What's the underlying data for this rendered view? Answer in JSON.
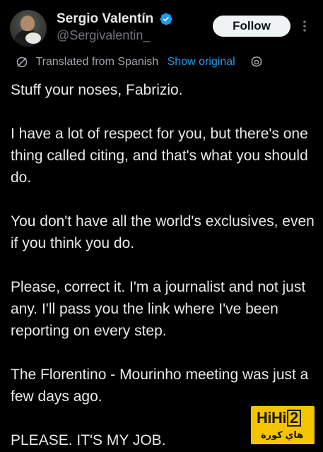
{
  "author": {
    "display_name": "Sergio Valentín",
    "handle": "@Sergivalentin_",
    "verified": true,
    "verified_color": "#1d9bf0"
  },
  "actions": {
    "follow_label": "Follow"
  },
  "translation": {
    "translated_label": "Translated from Spanish",
    "show_original_label": "Show original",
    "link_color": "#1d9bf0"
  },
  "tweet": {
    "paragraphs": [
      "Stuff your noses, Fabrizio.",
      "I have a lot of respect for you, but there's one thing called citing, and that's what you should do.",
      "You don't have all the world's exclusives, even if you think you do.",
      "Please, correct it. I'm a journalist and not just any. I'll pass you the link where I've been reporting on every step.",
      "The Florentino - Mourinho meeting was just a few days ago.",
      "PLEASE. IT'S MY JOB."
    ]
  },
  "watermark": {
    "brand_prefix": "HiHi",
    "brand_number": "2",
    "arabic_text": "هاي كورة",
    "background": "#f5c400"
  },
  "icons": {
    "verified": "verified-badge-icon",
    "more": "more-vertical-icon",
    "translate": "translate-icon",
    "settings": "settings-gear-icon"
  }
}
